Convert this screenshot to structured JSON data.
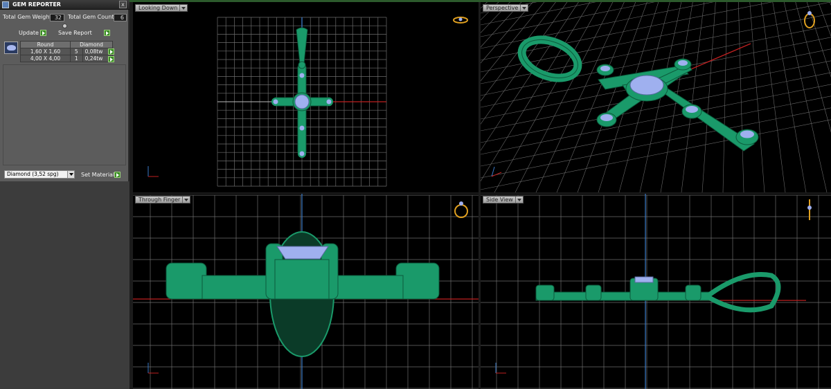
{
  "panel": {
    "title": "GEM REPORTER",
    "close": "x",
    "total_weight_label": "Total Gem Weight",
    "total_weight_value": "32",
    "total_count_label": "Total Gem Count",
    "total_count_value": "6",
    "update_label": "Update",
    "save_report_label": "Save Report",
    "table": {
      "headers": [
        "Round",
        "Diamond"
      ],
      "rows": [
        {
          "size": "1,60 X 1,60",
          "count": "5",
          "weight": "0,08tw"
        },
        {
          "size": "4,00 X 4,00",
          "count": "1",
          "weight": "0,24tw"
        }
      ]
    },
    "material_value": "Diamond    (3,52 spg)",
    "set_material_label": "Set Material"
  },
  "viewports": {
    "top_left": {
      "label": "Looking Down",
      "axis_v": "y",
      "axis_h": "x"
    },
    "top_right": {
      "label": "Perspective",
      "axis_v": "y",
      "axis_h": "x"
    },
    "bottom_left": {
      "label": "Through Finger",
      "axis_v": "z",
      "axis_h": "x"
    },
    "bottom_right": {
      "label": "Side View",
      "axis_v": "z",
      "axis_h": "x"
    }
  },
  "colors": {
    "metal": "#1a9a6a",
    "gem": "#9fb0ef",
    "grid": "#7a7a7a",
    "axis_red": "#c02020",
    "axis_blue": "#3a7ac8",
    "panel_bg": "#5c5c5c"
  }
}
